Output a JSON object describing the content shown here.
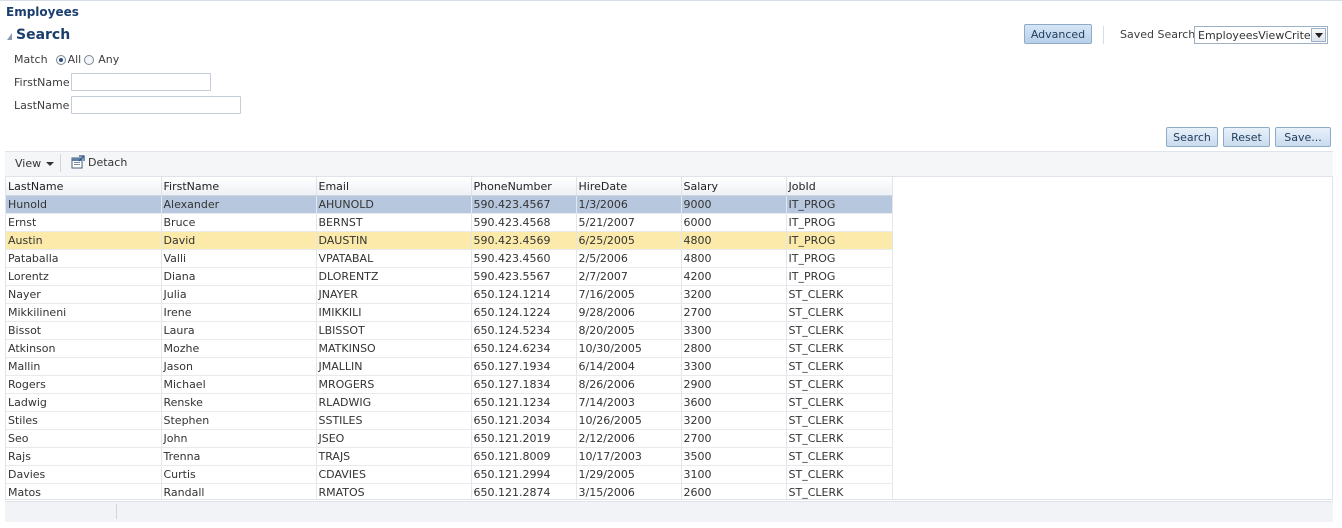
{
  "page": {
    "title": "Employees"
  },
  "search": {
    "title": "Search",
    "advanced_label": "Advanced",
    "saved_search_label": "Saved Search",
    "saved_search_value": "EmployeesViewCriteria",
    "match_label": "Match",
    "match_options": [
      "All",
      "Any"
    ],
    "match_selected": "All",
    "fields": [
      {
        "label": "FirstName",
        "value": ""
      },
      {
        "label": "LastName",
        "value": ""
      }
    ],
    "buttons": {
      "search": "Search",
      "reset": "Reset",
      "save": "Save..."
    }
  },
  "toolbar": {
    "view_label": "View",
    "detach_label": "Detach"
  },
  "table": {
    "columns": [
      "LastName",
      "FirstName",
      "Email",
      "PhoneNumber",
      "HireDate",
      "Salary",
      "JobId"
    ],
    "rows": [
      [
        "Hunold",
        "Alexander",
        "AHUNOLD",
        "590.423.4567",
        "1/3/2006",
        "9000",
        "IT_PROG"
      ],
      [
        "Ernst",
        "Bruce",
        "BERNST",
        "590.423.4568",
        "5/21/2007",
        "6000",
        "IT_PROG"
      ],
      [
        "Austin",
        "David",
        "DAUSTIN",
        "590.423.4569",
        "6/25/2005",
        "4800",
        "IT_PROG"
      ],
      [
        "Pataballa",
        "Valli",
        "VPATABAL",
        "590.423.4560",
        "2/5/2006",
        "4800",
        "IT_PROG"
      ],
      [
        "Lorentz",
        "Diana",
        "DLORENTZ",
        "590.423.5567",
        "2/7/2007",
        "4200",
        "IT_PROG"
      ],
      [
        "Nayer",
        "Julia",
        "JNAYER",
        "650.124.1214",
        "7/16/2005",
        "3200",
        "ST_CLERK"
      ],
      [
        "Mikkilineni",
        "Irene",
        "IMIKKILI",
        "650.124.1224",
        "9/28/2006",
        "2700",
        "ST_CLERK"
      ],
      [
        "Bissot",
        "Laura",
        "LBISSOT",
        "650.124.5234",
        "8/20/2005",
        "3300",
        "ST_CLERK"
      ],
      [
        "Atkinson",
        "Mozhe",
        "MATKINSO",
        "650.124.6234",
        "10/30/2005",
        "2800",
        "ST_CLERK"
      ],
      [
        "Mallin",
        "Jason",
        "JMALLIN",
        "650.127.1934",
        "6/14/2004",
        "3300",
        "ST_CLERK"
      ],
      [
        "Rogers",
        "Michael",
        "MROGERS",
        "650.127.1834",
        "8/26/2006",
        "2900",
        "ST_CLERK"
      ],
      [
        "Ladwig",
        "Renske",
        "RLADWIG",
        "650.121.1234",
        "7/14/2003",
        "3600",
        "ST_CLERK"
      ],
      [
        "Stiles",
        "Stephen",
        "SSTILES",
        "650.121.2034",
        "10/26/2005",
        "3200",
        "ST_CLERK"
      ],
      [
        "Seo",
        "John",
        "JSEO",
        "650.121.2019",
        "2/12/2006",
        "2700",
        "ST_CLERK"
      ],
      [
        "Rajs",
        "Trenna",
        "TRAJS",
        "650.121.8009",
        "10/17/2003",
        "3500",
        "ST_CLERK"
      ],
      [
        "Davies",
        "Curtis",
        "CDAVIES",
        "650.121.2994",
        "1/29/2005",
        "3100",
        "ST_CLERK"
      ],
      [
        "Matos",
        "Randall",
        "RMATOS",
        "650.121.2874",
        "3/15/2006",
        "2600",
        "ST_CLERK"
      ]
    ],
    "selected_row": 0,
    "hover_row": 2
  },
  "colors": {
    "accent": "#1a3f6e",
    "selected_row": "#b7c8de",
    "hover_row": "#fbeaa9"
  }
}
